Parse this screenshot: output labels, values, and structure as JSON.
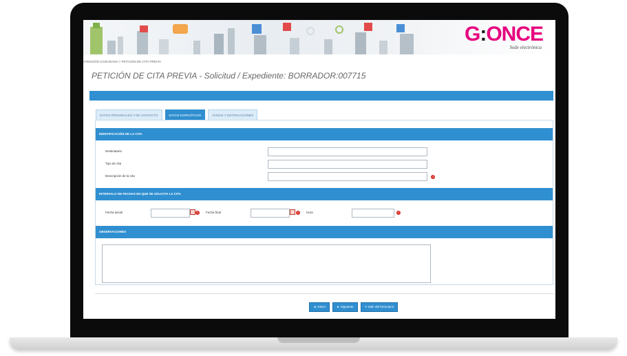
{
  "header": {
    "logo_text_main": "G",
    "logo_text_dot": ":",
    "logo_text_rest": "ONCE",
    "logo_subtitle": "Sede electrónica"
  },
  "breadcrumb": "ATENCIÓN CIUDADANA > PETICIÓN DE CITA PREVIA",
  "page_title": "PETICIÓN DE CITA PREVIA - Solicitud / Expediente: BORRADOR:007715",
  "tabs": [
    {
      "label": "DATOS PERSONALES Y DE CONTACTO"
    },
    {
      "label": "DATOS ESPECÍFICOS"
    },
    {
      "label": "AVISOS Y NOTIFICACIONES"
    }
  ],
  "sections": {
    "identificacion": "IDENTIFICACIÓN DE LA CITA",
    "intervalo": "INTERVALO DE FECHAS EN QUE SE SOLICITA LA CITA",
    "observaciones": "OBSERVACIONES"
  },
  "fields": {
    "destinatario": "Destinatario",
    "tipo_cita": "Tipo de cita",
    "descripcion": "Descripción de la cita",
    "fecha_inicial": "Fecha inicial",
    "fecha_final": "Fecha final",
    "hora": "Hora"
  },
  "buttons": {
    "volver": "◄ Volver",
    "siguiente": "► Siguiente",
    "salir": "Salir del formulario"
  },
  "colors": {
    "accent": "#2f8fd0",
    "brand": "#e6007e",
    "required": "#d9302c"
  }
}
